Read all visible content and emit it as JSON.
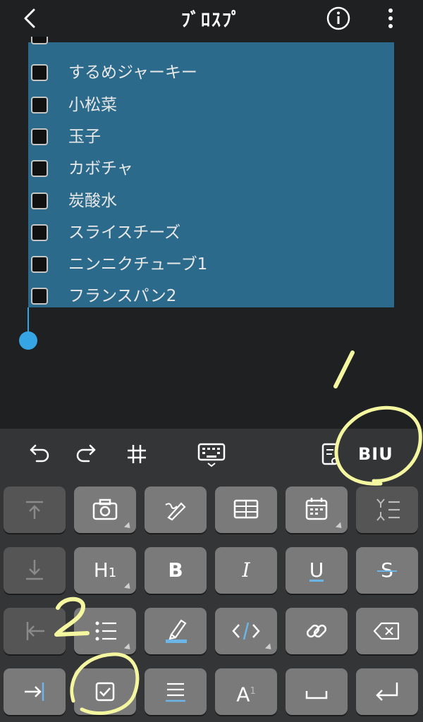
{
  "header": {
    "title": "ﾌﾞﾛｽﾌﾟ",
    "back_icon": "chevron-left-icon",
    "info_icon": "info-icon",
    "more_icon": "more-vertical-icon"
  },
  "checklist": {
    "items": [
      {
        "label": "するめジャーキー",
        "checked": false
      },
      {
        "label": "小松菜",
        "checked": false
      },
      {
        "label": "玉子",
        "checked": false
      },
      {
        "label": "カボチャ",
        "checked": false
      },
      {
        "label": "炭酸水",
        "checked": false
      },
      {
        "label": "スライスチーズ",
        "checked": false
      },
      {
        "label": "ニンニクチューブ1",
        "checked": false
      },
      {
        "label": "フランスパン2",
        "checked": false
      }
    ]
  },
  "toolbar": {
    "biu_label": "BIU",
    "icons": [
      "undo-icon",
      "redo-icon",
      "hashtag-icon",
      "keyboard-icon",
      "clipboard-icon",
      "biu-icon"
    ]
  },
  "keyboard": {
    "h1_label": "H",
    "h1_sub": "1",
    "bold_label": "B",
    "italic_label": "I",
    "underline_label": "U",
    "strike_label": "S",
    "font_label": "A",
    "font_sup": "1"
  },
  "annotations": {
    "mark1": "/",
    "mark2": "2"
  },
  "colors": {
    "background": "#1f2022",
    "selection": "#2c6a8c",
    "caret": "#35a6e3",
    "key": "#7a7a7a",
    "key_dim": "#555555",
    "annotation": "#f4f7a0"
  }
}
